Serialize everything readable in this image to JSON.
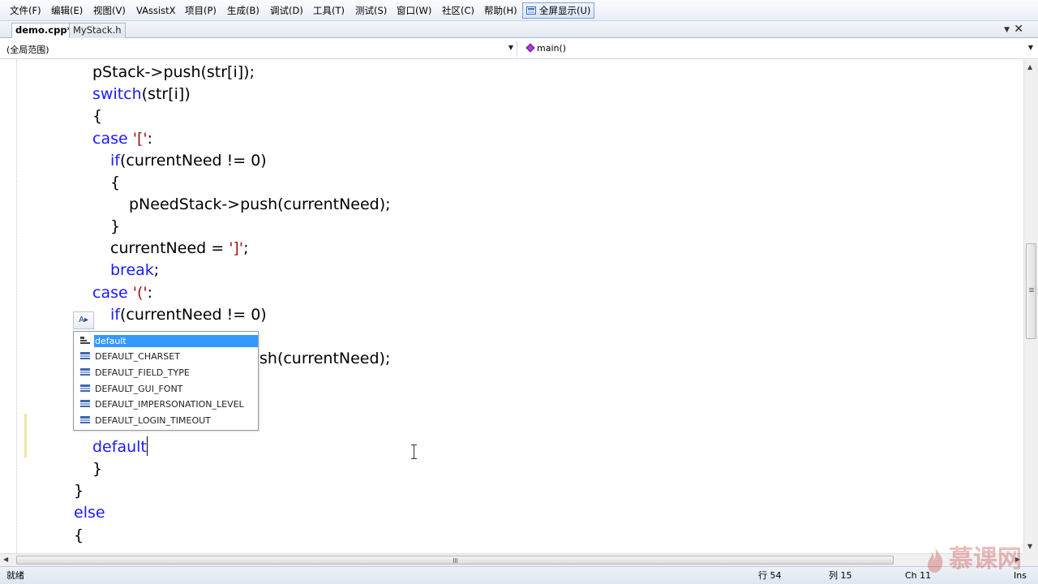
{
  "menu": {
    "items": [
      "文件(F)",
      "编辑(E)",
      "视图(V)",
      "VAssistX",
      "项目(P)",
      "生成(B)",
      "调试(D)",
      "工具(T)",
      "测试(S)",
      "窗口(W)",
      "社区(C)",
      "帮助(H)"
    ],
    "fullscreen_label": "全屏显示(U)"
  },
  "tabs": {
    "active": "demo.cpp*",
    "inactive": "MyStack.h",
    "close_glyph": "✕",
    "dropdown_glyph": "▼"
  },
  "navbar": {
    "scope": "(全局范围)",
    "member": "main()",
    "arrow_glyph": "▼"
  },
  "code": {
    "l1": "pStack->push(str[i]);",
    "l2_kw": "switch",
    "l2_rest": "(str[i])",
    "l3": "{",
    "l4_kw": "case",
    "l4_str": "'['",
    "l4_colon": ":",
    "l5_kw": "if",
    "l5_rest": "(currentNeed != 0)",
    "l6": "{",
    "l7": "pNeedStack->push(currentNeed);",
    "l8": "}",
    "l9_a": "currentNeed = ",
    "l9_str": "']'",
    "l9_semi": ";",
    "l10_kw": "break",
    "l10_semi": ";",
    "l11_kw": "case",
    "l11_str": "'('",
    "l11_colon": ":",
    "l12_kw": "if",
    "l12_rest": "(currentNeed != 0)",
    "l14": "sh(currentNeed);",
    "l19_kw": "default",
    "l20": "}",
    "l21": "}",
    "l22_kw": "else",
    "l23": "{"
  },
  "autocomplete": {
    "button_glyph": "A▸",
    "items": [
      "default",
      "DEFAULT_CHARSET",
      "DEFAULT_FIELD_TYPE",
      "DEFAULT_GUI_FONT",
      "DEFAULT_IMPERSONATION_LEVEL",
      "DEFAULT_LOGIN_TIMEOUT"
    ],
    "selected_index": 0
  },
  "scroll": {
    "up_glyph": "▲",
    "down_glyph": "▼",
    "left_glyph": "◀",
    "right_glyph": "▶"
  },
  "status": {
    "ready": "就绪",
    "line": "行 54",
    "col": "列 15",
    "ch": "Ch 11",
    "mode": "Ins"
  },
  "watermark": {
    "text": "慕课网"
  },
  "colors": {
    "keyword": "#1a1aff",
    "string": "#a31515",
    "selection": "#3399ff"
  }
}
